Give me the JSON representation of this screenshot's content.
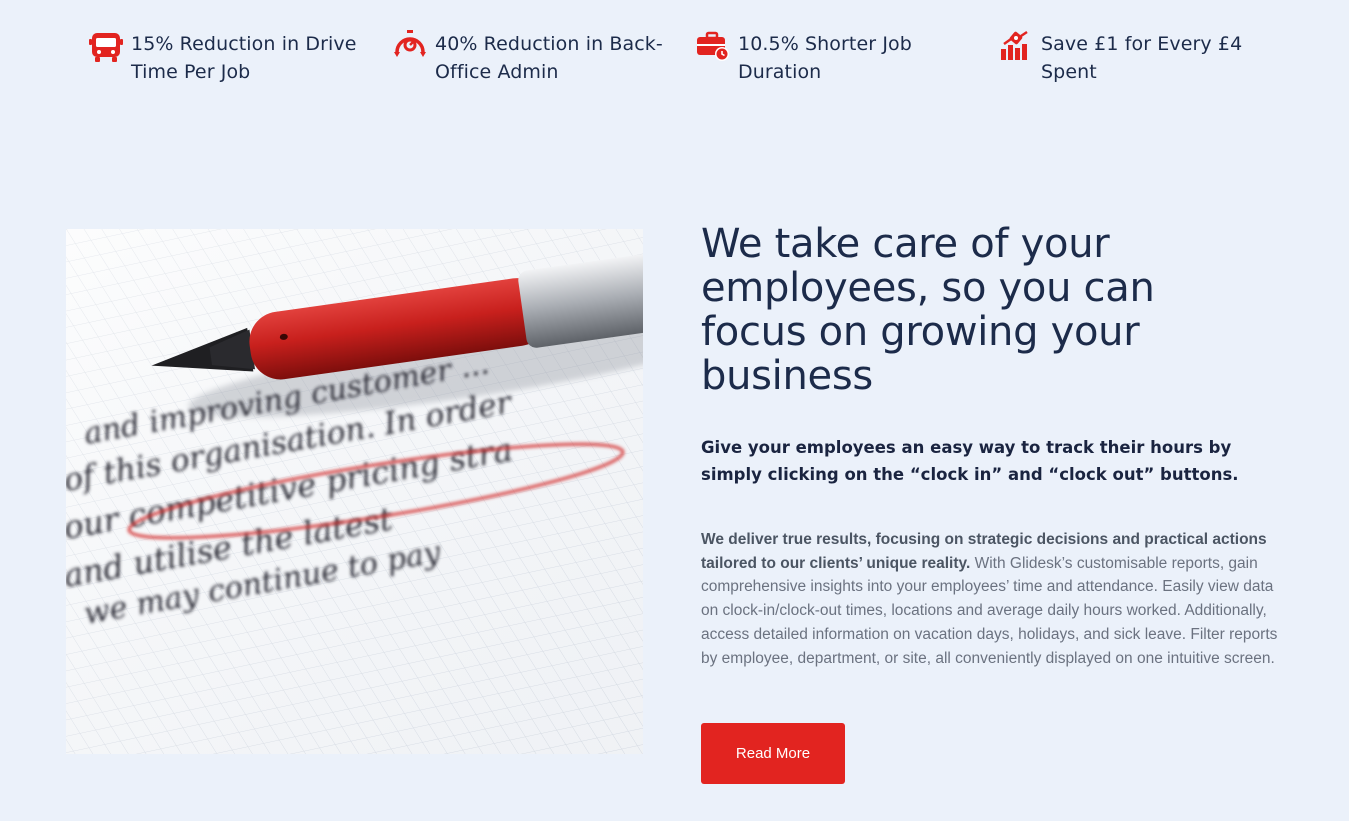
{
  "stats": [
    {
      "icon": "bus-icon",
      "label": "15% Reduction in Drive Time Per Job"
    },
    {
      "icon": "timer-icon",
      "label": "40% Reduction in Back-Office Admin"
    },
    {
      "icon": "briefcase-clock-icon",
      "label": "10.5% Shorter Job Duration"
    },
    {
      "icon": "chart-savings-icon",
      "label": "Save £1 for Every £4 Spent"
    }
  ],
  "hero_image": {
    "handwriting_lines": [
      "and improving customer ...",
      "of this organisation. In order",
      "our competitive pricing stra",
      "and utilise the latest",
      "we may continue to pay"
    ]
  },
  "content": {
    "headline": "We take care of your employees, so you can focus on growing your business",
    "subhead": "Give your employees an easy way to track their hours by simply clicking on the “clock in” and “clock out” buttons.",
    "body_bold": "We deliver true results, focusing on strategic decisions and practical actions tailored to our clients’ unique reality.",
    "body_rest": " With Glidesk’s customisable reports, gain comprehensive insights into your employees’ time and attendance. Easily view data on clock-in/clock-out times, locations and average daily hours worked. Additionally, access detailed information on vacation days, holidays, and sick leave. Filter reports by employee, department, or site, all conveniently displayed on one intuitive screen.",
    "button_label": "Read More"
  },
  "colors": {
    "accent": "#e22420",
    "heading": "#1c2b4a",
    "background": "#ebf1fa"
  }
}
